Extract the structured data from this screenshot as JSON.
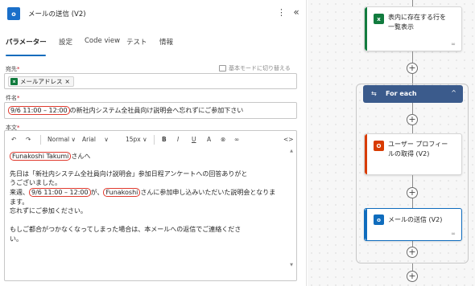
{
  "panel": {
    "app_icon": "outlook-icon",
    "app_icon_text": "o",
    "title": "メールの送信 (V2)",
    "more_icon": "⋮",
    "collapse_icon": "«"
  },
  "tabs": [
    "パラメーター",
    "設定",
    "Code view",
    "テスト",
    "情報"
  ],
  "to": {
    "label": "宛先",
    "required": "*",
    "switch_mode": "基本モードに切り替える",
    "token": "メールアドレス",
    "token_remove": "×",
    "token_icon_text": "x"
  },
  "subject": {
    "label": "件名",
    "required": "*",
    "highlight": "9/6 11:00 – 12:00",
    "rest": "の新社内システム全社員向け説明会へ忘れずにご参加下さい"
  },
  "body": {
    "label": "本文",
    "required": "*",
    "toolbar": {
      "undo": "↶",
      "redo": "↷",
      "style": "Normal",
      "font": "Arial",
      "size": "15px",
      "bold": "B",
      "italic": "I",
      "underline": "U",
      "font_color": "A",
      "highlight": "⊗",
      "link": "∞",
      "code": "<>",
      "dropdown": "∨"
    },
    "line1_highlight": "Funakoshi Takumi",
    "line1_rest": "さんへ",
    "line2": "先日は「新社内システム全社員向け説明会」参加日程アンケートへの回答ありがと",
    "line3": "うございました。",
    "line4_a": "来週、",
    "line4_hl1": "9/6 11:00 – 12:00",
    "line4_b": "が、",
    "line4_hl2": "Funakoshi",
    "line4_c": "さんに参加申し込みいただいた説明会となりま",
    "line5": "ます。",
    "line6": "忘れずにご参加ください。",
    "line7": "もしご都合がつかなくなってしまった場合は、本メールへの返信でご連絡くださ",
    "line8": "い。",
    "scroll_up": "▲",
    "scroll_down": "▼"
  },
  "canvas": {
    "card_list_rows": {
      "icon": "excel-icon",
      "icon_text": "x",
      "line1": "表内に存在する行を",
      "line2": "一覧表示",
      "color": "#117b3e"
    },
    "foreach": {
      "label": "For each",
      "icon": "⇆",
      "chevron": "^",
      "color": "#3b5b8c"
    },
    "card_profile": {
      "icon": "office-icon",
      "icon_text": "O",
      "line1": "ユーザー プロフィー",
      "line2": "ルの取得 (V2)",
      "color": "#d83b01"
    },
    "card_send_mail": {
      "icon": "outlook-icon",
      "icon_text": "o",
      "line1": "メールの送信 (V2)",
      "color": "#0f6cbd"
    },
    "plus": "+",
    "link_glyph": "∞"
  },
  "colors": {
    "accent": "#0f6cbd",
    "highlight_box": "#e03a2e",
    "required": "#c50f1f"
  }
}
